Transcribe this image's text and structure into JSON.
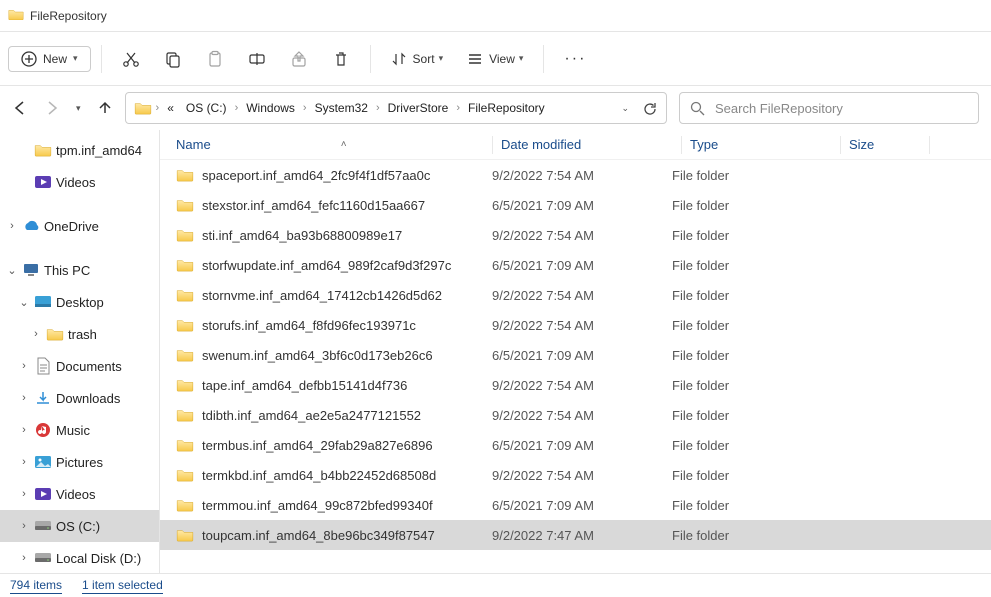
{
  "window": {
    "title": "FileRepository"
  },
  "toolbar": {
    "new_label": "New",
    "sort_label": "Sort",
    "view_label": "View"
  },
  "breadcrumbs": [
    "OS (C:)",
    "Windows",
    "System32",
    "DriverStore",
    "FileRepository"
  ],
  "search": {
    "placeholder": "Search FileRepository"
  },
  "sidebar": {
    "items": [
      {
        "label": "tpm.inf_amd64",
        "icon": "folder",
        "indent": 2,
        "chev": ""
      },
      {
        "label": "Videos",
        "icon": "videos",
        "indent": 2,
        "chev": ""
      },
      {
        "label": "OneDrive",
        "icon": "cloud",
        "indent": 1,
        "chev": ">"
      },
      {
        "label": "This PC",
        "icon": "pc",
        "indent": 1,
        "chev": "v"
      },
      {
        "label": "Desktop",
        "icon": "desktop",
        "indent": 2,
        "chev": "v"
      },
      {
        "label": "trash",
        "icon": "folder",
        "indent": 3,
        "chev": ">"
      },
      {
        "label": "Documents",
        "icon": "documents",
        "indent": 2,
        "chev": ">"
      },
      {
        "label": "Downloads",
        "icon": "downloads",
        "indent": 2,
        "chev": ">"
      },
      {
        "label": "Music",
        "icon": "music",
        "indent": 2,
        "chev": ">"
      },
      {
        "label": "Pictures",
        "icon": "pictures",
        "indent": 2,
        "chev": ">"
      },
      {
        "label": "Videos",
        "icon": "videos",
        "indent": 2,
        "chev": ">"
      },
      {
        "label": "OS (C:)",
        "icon": "drive",
        "indent": 2,
        "chev": ">",
        "selected": true
      },
      {
        "label": "Local Disk (D:)",
        "icon": "drive",
        "indent": 2,
        "chev": ">"
      }
    ]
  },
  "columns": {
    "name": "Name",
    "date": "Date modified",
    "type": "Type",
    "size": "Size"
  },
  "files": [
    {
      "name": "spaceport.inf_amd64_2fc9f4f1df57aa0c",
      "date": "9/2/2022 7:54 AM",
      "type": "File folder"
    },
    {
      "name": "stexstor.inf_amd64_fefc1160d15aa667",
      "date": "6/5/2021 7:09 AM",
      "type": "File folder"
    },
    {
      "name": "sti.inf_amd64_ba93b68800989e17",
      "date": "9/2/2022 7:54 AM",
      "type": "File folder"
    },
    {
      "name": "storfwupdate.inf_amd64_989f2caf9d3f297c",
      "date": "6/5/2021 7:09 AM",
      "type": "File folder"
    },
    {
      "name": "stornvme.inf_amd64_17412cb1426d5d62",
      "date": "9/2/2022 7:54 AM",
      "type": "File folder"
    },
    {
      "name": "storufs.inf_amd64_f8fd96fec193971c",
      "date": "9/2/2022 7:54 AM",
      "type": "File folder"
    },
    {
      "name": "swenum.inf_amd64_3bf6c0d173eb26c6",
      "date": "6/5/2021 7:09 AM",
      "type": "File folder"
    },
    {
      "name": "tape.inf_amd64_defbb15141d4f736",
      "date": "9/2/2022 7:54 AM",
      "type": "File folder"
    },
    {
      "name": "tdibth.inf_amd64_ae2e5a2477121552",
      "date": "9/2/2022 7:54 AM",
      "type": "File folder"
    },
    {
      "name": "termbus.inf_amd64_29fab29a827e6896",
      "date": "6/5/2021 7:09 AM",
      "type": "File folder"
    },
    {
      "name": "termkbd.inf_amd64_b4bb22452d68508d",
      "date": "9/2/2022 7:54 AM",
      "type": "File folder"
    },
    {
      "name": "termmou.inf_amd64_99c872bfed99340f",
      "date": "6/5/2021 7:09 AM",
      "type": "File folder"
    },
    {
      "name": "toupcam.inf_amd64_8be96bc349f87547",
      "date": "9/2/2022 7:47 AM",
      "type": "File folder",
      "selected": true
    }
  ],
  "status": {
    "count": "794 items",
    "selection": "1 item selected"
  }
}
